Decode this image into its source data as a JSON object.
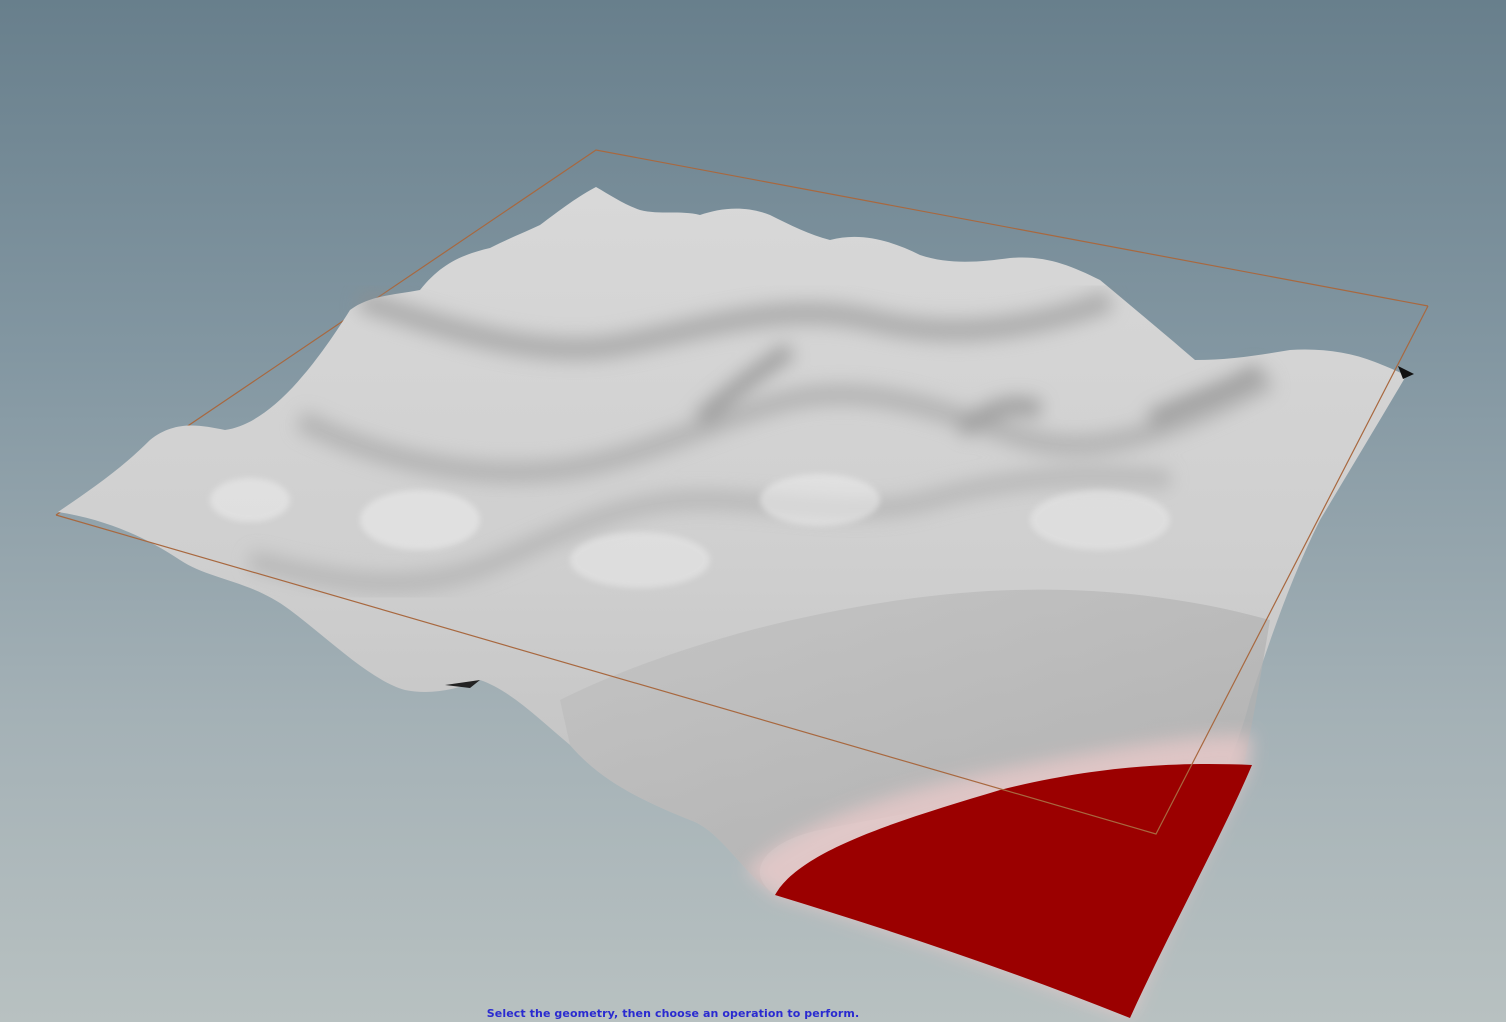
{
  "viewport": {
    "background_top": "#687f8c",
    "background_bottom": "#b8c1c1",
    "bounding_box_color": "#a8683f",
    "terrain_color": "#c8c8c8",
    "mask_color": "#9b0000"
  },
  "status": {
    "prompt": "Select the geometry, then choose an operation to perform."
  },
  "icons": {
    "handle": "handle-icon"
  }
}
